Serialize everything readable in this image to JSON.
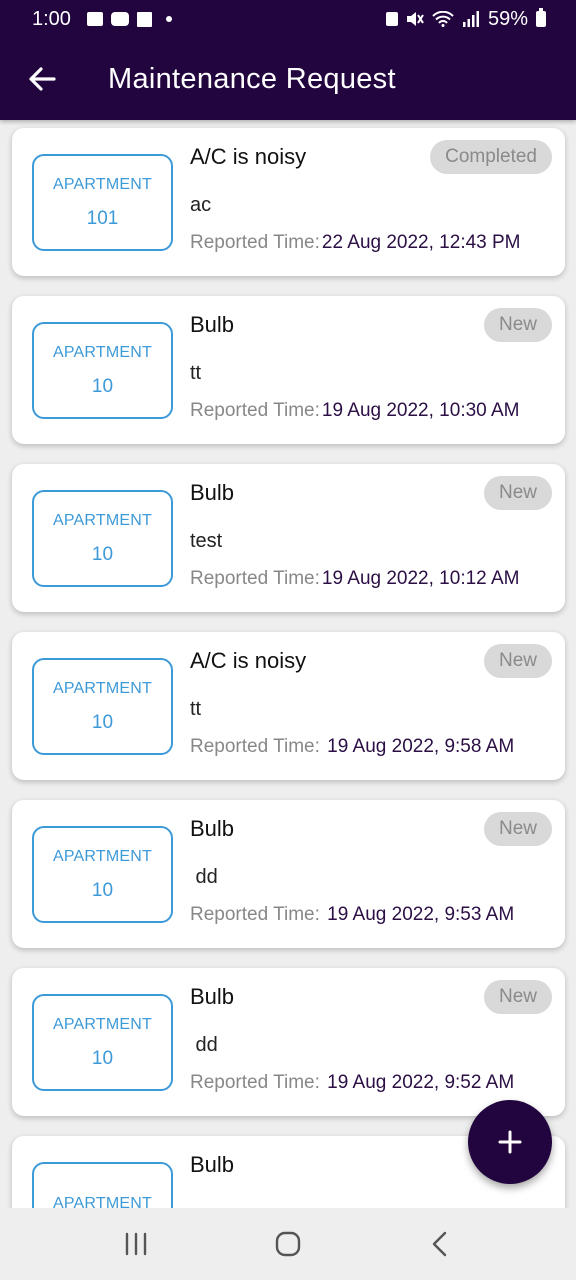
{
  "status_bar": {
    "time": "1:00",
    "battery": "59%",
    "icons": [
      "gallery-icon",
      "youtube-icon",
      "calendar-icon",
      "dot-icon",
      "alarm-icon",
      "mute-icon",
      "wifi-icon",
      "signal-icon",
      "battery-icon"
    ]
  },
  "appbar": {
    "title": "Maintenance Request",
    "back_icon": "arrow-left-icon"
  },
  "colors": {
    "primary": "#22053f",
    "apartment_accent": "#3d9ad8",
    "badge_bg": "#d9d9d9",
    "badge_text": "#8a8a8a"
  },
  "requests": [
    {
      "apartment_label": "APARTMENT",
      "apartment_number": "101",
      "title": "A/C is noisy",
      "status": "Completed",
      "description": "ac",
      "reported_label": "Reported Time:",
      "reported_time": "22 Aug 2022, 12:43 PM"
    },
    {
      "apartment_label": "APARTMENT",
      "apartment_number": "10",
      "title": "Bulb",
      "status": "New",
      "description": "tt",
      "reported_label": "Reported Time:",
      "reported_time": "19 Aug 2022, 10:30 AM"
    },
    {
      "apartment_label": "APARTMENT",
      "apartment_number": "10",
      "title": "Bulb",
      "status": "New",
      "description": "test",
      "reported_label": "Reported Time:",
      "reported_time": "19 Aug 2022, 10:12 AM"
    },
    {
      "apartment_label": "APARTMENT",
      "apartment_number": "10",
      "title": "A/C is noisy",
      "status": "New",
      "description": "tt",
      "reported_label": "Reported Time:",
      "reported_time": " 19 Aug 2022, 9:58 AM"
    },
    {
      "apartment_label": "APARTMENT",
      "apartment_number": "10",
      "title": "Bulb",
      "status": "New",
      "description": " dd",
      "reported_label": "Reported Time:",
      "reported_time": " 19 Aug 2022, 9:53 AM"
    },
    {
      "apartment_label": "APARTMENT",
      "apartment_number": "10",
      "title": "Bulb",
      "status": "New",
      "description": " dd",
      "reported_label": "Reported Time:",
      "reported_time": " 19 Aug 2022, 9:52 AM"
    },
    {
      "apartment_label": "APARTMENT",
      "apartment_number": "",
      "title": "Bulb",
      "status": "",
      "description": "",
      "reported_label": "",
      "reported_time": ""
    }
  ],
  "fab": {
    "icon": "plus-icon"
  },
  "nav_bar": {
    "icons": [
      "recent-apps-icon",
      "home-icon",
      "back-icon"
    ]
  }
}
